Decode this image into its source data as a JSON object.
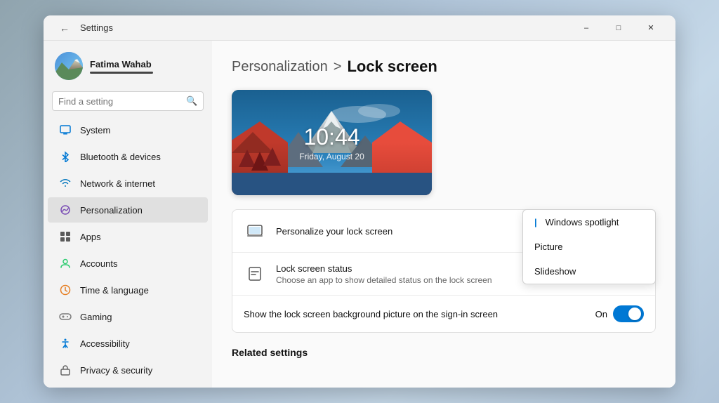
{
  "window": {
    "title": "Settings",
    "controls": {
      "minimize": "–",
      "maximize": "□",
      "close": "✕"
    }
  },
  "sidebar": {
    "user": {
      "name": "Fatima Wahab"
    },
    "search": {
      "placeholder": "Find a setting"
    },
    "nav": [
      {
        "id": "system",
        "label": "System",
        "iconType": "system"
      },
      {
        "id": "bluetooth",
        "label": "Bluetooth & devices",
        "iconType": "bluetooth"
      },
      {
        "id": "network",
        "label": "Network & internet",
        "iconType": "network"
      },
      {
        "id": "personalization",
        "label": "Personalization",
        "iconType": "personalization",
        "active": true
      },
      {
        "id": "apps",
        "label": "Apps",
        "iconType": "apps"
      },
      {
        "id": "accounts",
        "label": "Accounts",
        "iconType": "accounts"
      },
      {
        "id": "time",
        "label": "Time & language",
        "iconType": "time"
      },
      {
        "id": "gaming",
        "label": "Gaming",
        "iconType": "gaming"
      },
      {
        "id": "accessibility",
        "label": "Accessibility",
        "iconType": "accessibility"
      },
      {
        "id": "privacy",
        "label": "Privacy & security",
        "iconType": "privacy"
      }
    ]
  },
  "main": {
    "breadcrumb": {
      "parent": "Personalization",
      "separator": ">",
      "current": "Lock screen"
    },
    "preview": {
      "time": "10:44",
      "date": "Friday, August 20"
    },
    "settings": [
      {
        "id": "personalize-lock",
        "label": "Personalize your lock screen",
        "desc": "",
        "controlType": "dropdown",
        "dropdownOpen": true,
        "dropdownOptions": [
          "Windows spotlight",
          "Picture",
          "Slideshow"
        ],
        "selectedOption": "Windows spotlight"
      },
      {
        "id": "lock-status",
        "label": "Lock screen status",
        "desc": "Choose an app to show detailed status on the lock screen",
        "controlType": "none"
      },
      {
        "id": "show-bg",
        "label": "Show the lock screen background picture on the sign-in screen",
        "desc": "",
        "controlType": "toggle",
        "toggleState": true,
        "toggleLabel": "On"
      }
    ],
    "relatedSettings": {
      "title": "Related settings"
    }
  }
}
